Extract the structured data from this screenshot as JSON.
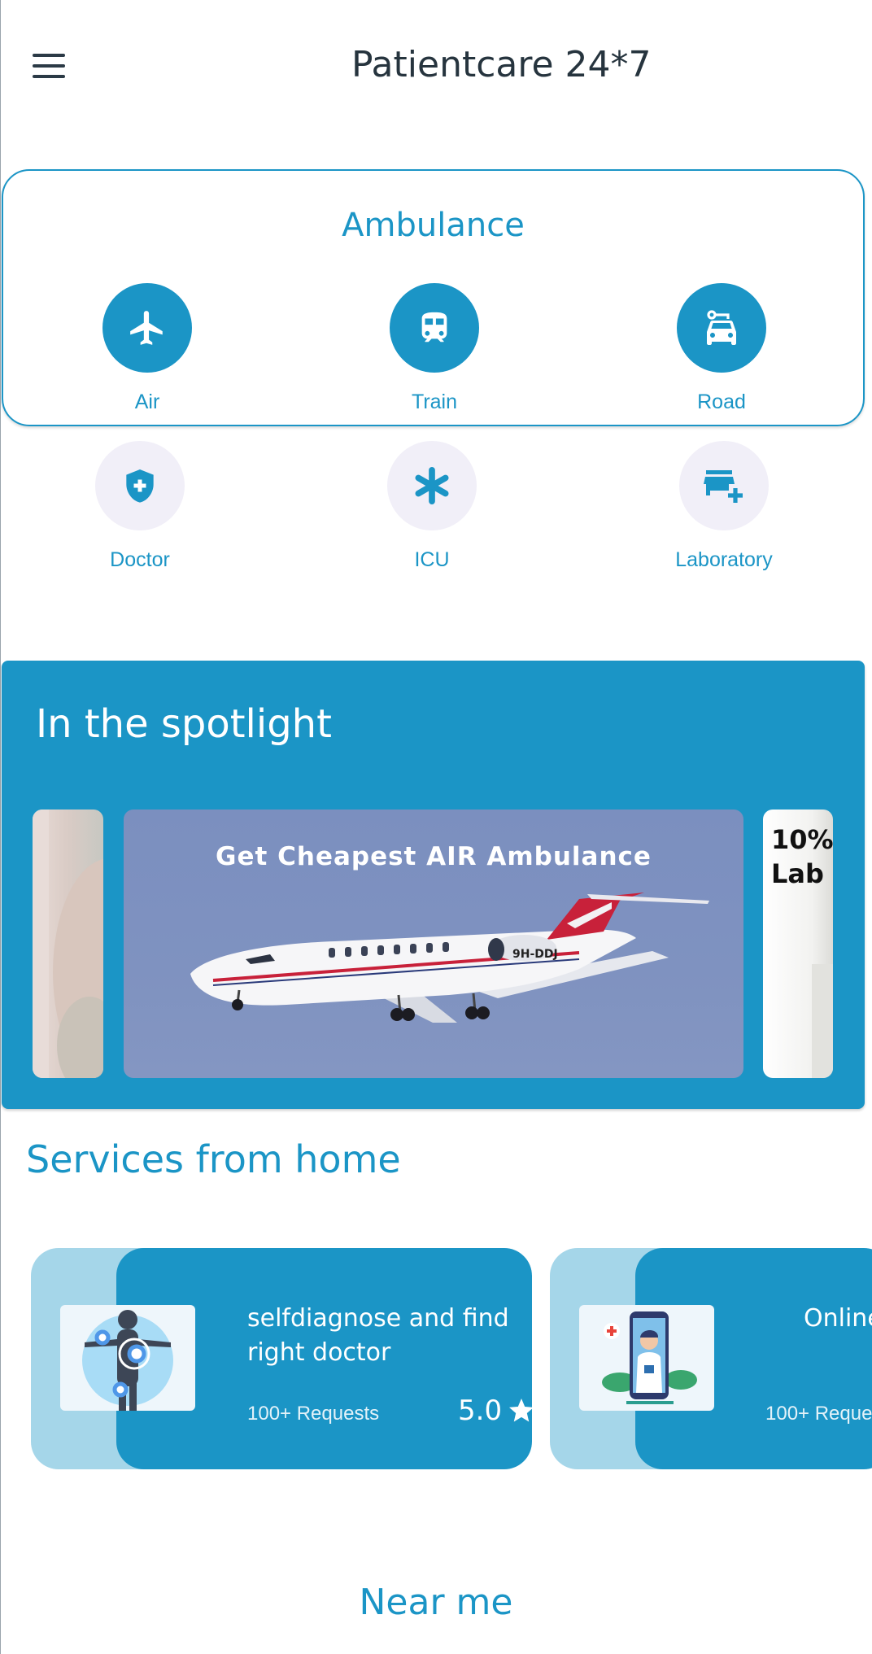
{
  "header": {
    "title": "Patientcare 24*7",
    "menu_icon": "menu-icon"
  },
  "ambulance": {
    "title": "Ambulance",
    "items": [
      {
        "label": "Air",
        "icon": "airplane-icon"
      },
      {
        "label": "Train",
        "icon": "train-icon"
      },
      {
        "label": "Road",
        "icon": "car-icon"
      }
    ]
  },
  "services": [
    {
      "label": "Doctor",
      "icon": "shield-plus-icon"
    },
    {
      "label": "ICU",
      "icon": "asterisk-icon"
    },
    {
      "label": "Laboratory",
      "icon": "store-plus-icon"
    }
  ],
  "spotlight": {
    "title": "In the spotlight",
    "main_banner_caption": "Get Cheapest AIR Ambulance",
    "right_banner_text": "10%\nLab",
    "plane_registration": "9H-DDJ"
  },
  "services_from_home": {
    "title": "Services from home",
    "cards": [
      {
        "name": "selfdiagnose and find right doctor",
        "requests": "100+ Requests",
        "rating": "5.0"
      },
      {
        "name": "Online",
        "requests": "100+ Reque",
        "rating": ""
      }
    ]
  },
  "near_me": {
    "label": "Near me"
  },
  "colors": {
    "primary": "#1b95c6",
    "primary_light": "#a5d6e9",
    "icon_bg": "#f1eff8"
  }
}
